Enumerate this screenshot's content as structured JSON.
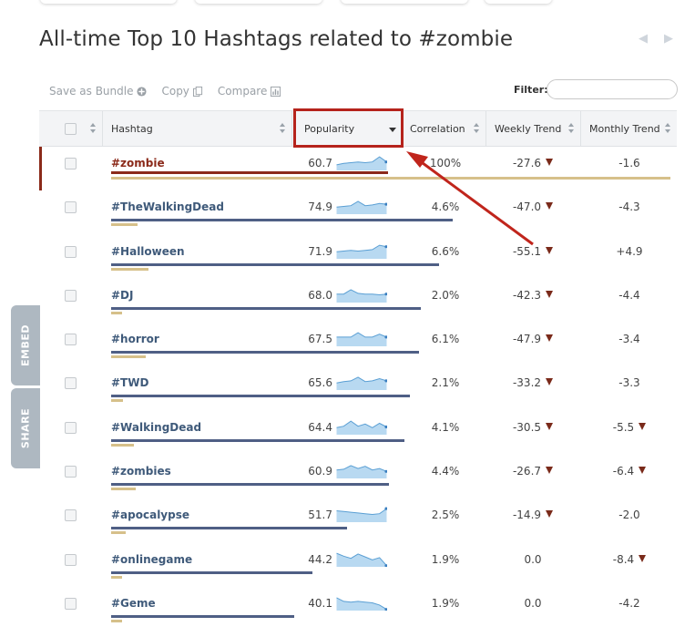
{
  "page": {
    "title": "All-time Top 10 Hashtags related to #zombie"
  },
  "toolbar": {
    "save_label": "Save as Bundle",
    "copy_label": "Copy",
    "compare_label": "Compare",
    "filter_label": "Filter:",
    "filter_value": ""
  },
  "side_tabs": {
    "embed": "EMBED",
    "share": "SHARE"
  },
  "table": {
    "columns": {
      "hashtag": "Hashtag",
      "popularity": "Popularity",
      "correlation": "Correlation",
      "weekly": "Weekly Trend",
      "monthly": "Monthly Trend"
    },
    "sorted_by": "Popularity",
    "rows": [
      {
        "hashtag": "#zombie",
        "popularity": "60.7",
        "correlation": "100%",
        "weekly": "-27.6",
        "weekly_down": true,
        "monthly": "-1.6",
        "monthly_down": false,
        "active": true,
        "popularity_fraction": 0.607,
        "correlation_fraction": 1.0,
        "spark": [
          0.35,
          0.45,
          0.5,
          0.55,
          0.5,
          0.55,
          0.9,
          0.55
        ]
      },
      {
        "hashtag": "#TheWalkingDead",
        "popularity": "74.9",
        "correlation": "4.6%",
        "weekly": "-47.0",
        "weekly_down": true,
        "monthly": "-4.3",
        "monthly_down": false,
        "active": false,
        "popularity_fraction": 0.749,
        "correlation_fraction": 0.046,
        "spark": [
          0.45,
          0.5,
          0.55,
          0.85,
          0.55,
          0.6,
          0.7,
          0.65
        ]
      },
      {
        "hashtag": "#Halloween",
        "popularity": "71.9",
        "correlation": "6.6%",
        "weekly": "-55.1",
        "weekly_down": true,
        "monthly": "+4.9",
        "monthly_down": false,
        "active": false,
        "popularity_fraction": 0.719,
        "correlation_fraction": 0.066,
        "spark": [
          0.45,
          0.5,
          0.55,
          0.5,
          0.55,
          0.6,
          0.9,
          0.8
        ]
      },
      {
        "hashtag": "#DJ",
        "popularity": "68.0",
        "correlation": "2.0%",
        "weekly": "-42.3",
        "weekly_down": true,
        "monthly": "-4.4",
        "monthly_down": false,
        "active": false,
        "popularity_fraction": 0.68,
        "correlation_fraction": 0.02,
        "spark": [
          0.55,
          0.55,
          0.85,
          0.6,
          0.55,
          0.55,
          0.5,
          0.55
        ]
      },
      {
        "hashtag": "#horror",
        "popularity": "67.5",
        "correlation": "6.1%",
        "weekly": "-47.9",
        "weekly_down": true,
        "monthly": "-3.4",
        "monthly_down": false,
        "active": false,
        "popularity_fraction": 0.675,
        "correlation_fraction": 0.061,
        "spark": [
          0.6,
          0.6,
          0.6,
          0.9,
          0.6,
          0.6,
          0.8,
          0.6
        ]
      },
      {
        "hashtag": "#TWD",
        "popularity": "65.6",
        "correlation": "2.1%",
        "weekly": "-33.2",
        "weekly_down": true,
        "monthly": "-3.3",
        "monthly_down": false,
        "active": false,
        "popularity_fraction": 0.656,
        "correlation_fraction": 0.021,
        "spark": [
          0.45,
          0.55,
          0.6,
          0.85,
          0.55,
          0.6,
          0.75,
          0.6
        ]
      },
      {
        "hashtag": "#WalkingDead",
        "popularity": "64.4",
        "correlation": "4.1%",
        "weekly": "-30.5",
        "weekly_down": true,
        "monthly": "-5.5",
        "monthly_down": true,
        "active": false,
        "popularity_fraction": 0.644,
        "correlation_fraction": 0.041,
        "spark": [
          0.45,
          0.55,
          0.9,
          0.55,
          0.7,
          0.45,
          0.75,
          0.5
        ]
      },
      {
        "hashtag": "#zombies",
        "popularity": "60.9",
        "correlation": "4.4%",
        "weekly": "-26.7",
        "weekly_down": true,
        "monthly": "-6.4",
        "monthly_down": true,
        "active": false,
        "popularity_fraction": 0.609,
        "correlation_fraction": 0.044,
        "spark": [
          0.55,
          0.6,
          0.85,
          0.65,
          0.8,
          0.55,
          0.65,
          0.45
        ]
      },
      {
        "hashtag": "#apocalypse",
        "popularity": "51.7",
        "correlation": "2.5%",
        "weekly": "-14.9",
        "weekly_down": true,
        "monthly": "-2.0",
        "monthly_down": false,
        "active": false,
        "popularity_fraction": 0.517,
        "correlation_fraction": 0.025,
        "spark": [
          0.75,
          0.7,
          0.65,
          0.6,
          0.55,
          0.5,
          0.55,
          0.9
        ]
      },
      {
        "hashtag": "#onlinegame",
        "popularity": "44.2",
        "correlation": "1.9%",
        "weekly": "0.0",
        "weekly_down": false,
        "monthly": "-8.4",
        "monthly_down": true,
        "active": false,
        "popularity_fraction": 0.442,
        "correlation_fraction": 0.019,
        "spark": [
          0.9,
          0.7,
          0.55,
          0.85,
          0.65,
          0.45,
          0.6,
          0.05
        ]
      },
      {
        "hashtag": "#Geme",
        "popularity": "40.1",
        "correlation": "1.9%",
        "weekly": "0.0",
        "weekly_down": false,
        "monthly": "-4.2",
        "monthly_down": false,
        "active": false,
        "popularity_fraction": 0.401,
        "correlation_fraction": 0.019,
        "spark": [
          0.85,
          0.6,
          0.55,
          0.6,
          0.55,
          0.5,
          0.35,
          0.05
        ]
      }
    ]
  },
  "colors": {
    "accent_red": "#b5231c",
    "active_row": "#8b2a1a",
    "popularity_bar": "#4f5f85",
    "correlation_bar": "#d6c08a",
    "sparkline_fill": "#b8d9f1",
    "sparkline_line": "#5a9fd4",
    "trend_down": "#7a2a1a"
  }
}
